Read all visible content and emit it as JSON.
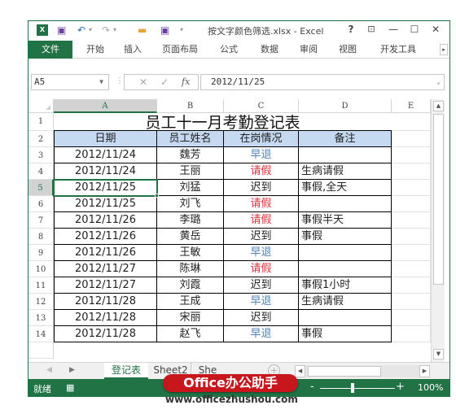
{
  "window": {
    "title": "按文字颜色筛选.xlsx - Excel",
    "controls": {
      "help": "?",
      "ribbon_display": "⊡",
      "minimize": "—",
      "maximize": "☐",
      "close": "✕"
    }
  },
  "qat": {
    "icons": [
      "excel-logo",
      "save-icon",
      "undo-icon",
      "redo-icon",
      "open-folder-icon",
      "save-as-icon",
      "customize-icon"
    ]
  },
  "ribbon": {
    "tabs": [
      "文件",
      "开始",
      "插入",
      "页面布局",
      "公式",
      "数据",
      "审阅",
      "视图",
      "开发工具"
    ],
    "more": "▸"
  },
  "formula_bar": {
    "name_box": "A5",
    "cancel": "✕",
    "enter": "✓",
    "fx": "fx",
    "value": "2012/11/25"
  },
  "columns": [
    "A",
    "B",
    "C",
    "D",
    "E"
  ],
  "selected_column": "A",
  "selected_row": 5,
  "rows": [
    "1",
    "2",
    "3",
    "4",
    "5",
    "6",
    "7",
    "8",
    "9",
    "10",
    "11",
    "12",
    "13",
    "14"
  ],
  "sheet": {
    "title": "员工十一月考勤登记表",
    "headers": [
      "日期",
      "员工姓名",
      "在岗情况",
      "备注"
    ],
    "records": [
      {
        "date": "2012/11/24",
        "name": "魏芳",
        "status": "早退",
        "status_color": "blue",
        "note": ""
      },
      {
        "date": "2012/11/24",
        "name": "王丽",
        "status": "请假",
        "status_color": "red",
        "note": "生病请假"
      },
      {
        "date": "2012/11/25",
        "name": "刘猛",
        "status": "迟到",
        "status_color": "black",
        "note": "事假,全天"
      },
      {
        "date": "2012/11/25",
        "name": "刘飞",
        "status": "请假",
        "status_color": "red",
        "note": ""
      },
      {
        "date": "2012/11/26",
        "name": "李璐",
        "status": "请假",
        "status_color": "red",
        "note": "事假半天"
      },
      {
        "date": "2012/11/26",
        "name": "黄岳",
        "status": "迟到",
        "status_color": "black",
        "note": "事假"
      },
      {
        "date": "2012/11/26",
        "name": "王敏",
        "status": "早退",
        "status_color": "blue",
        "note": ""
      },
      {
        "date": "2012/11/27",
        "name": "陈琳",
        "status": "请假",
        "status_color": "red",
        "note": ""
      },
      {
        "date": "2012/11/27",
        "name": "刘霞",
        "status": "迟到",
        "status_color": "black",
        "note": "事假1小时"
      },
      {
        "date": "2012/11/28",
        "name": "王成",
        "status": "早退",
        "status_color": "blue",
        "note": "生病请假"
      },
      {
        "date": "2012/11/28",
        "name": "宋丽",
        "status": "迟到",
        "status_color": "black",
        "note": ""
      },
      {
        "date": "2012/11/28",
        "name": "赵飞",
        "status": "早退",
        "status_color": "blue",
        "note": "事假"
      }
    ]
  },
  "sheet_tabs": {
    "prev": "◀",
    "next": "▶",
    "tabs": [
      "登记表",
      "Sheet2",
      "She"
    ],
    "active": 0,
    "add": "+"
  },
  "status_bar": {
    "status": "就绪",
    "zoom_minus": "-",
    "zoom_plus": "+",
    "zoom_level": "100%",
    "zoom_percent": 100
  },
  "watermark": {
    "badge": "Office办公助手",
    "url": "www.officezhushou.com"
  },
  "colors": {
    "accent": "#217346",
    "header_fill": "#c5d9f1",
    "blue_text": "#4f81bd",
    "red_text": "#e0303a",
    "watermark_red": "#c8161d"
  }
}
